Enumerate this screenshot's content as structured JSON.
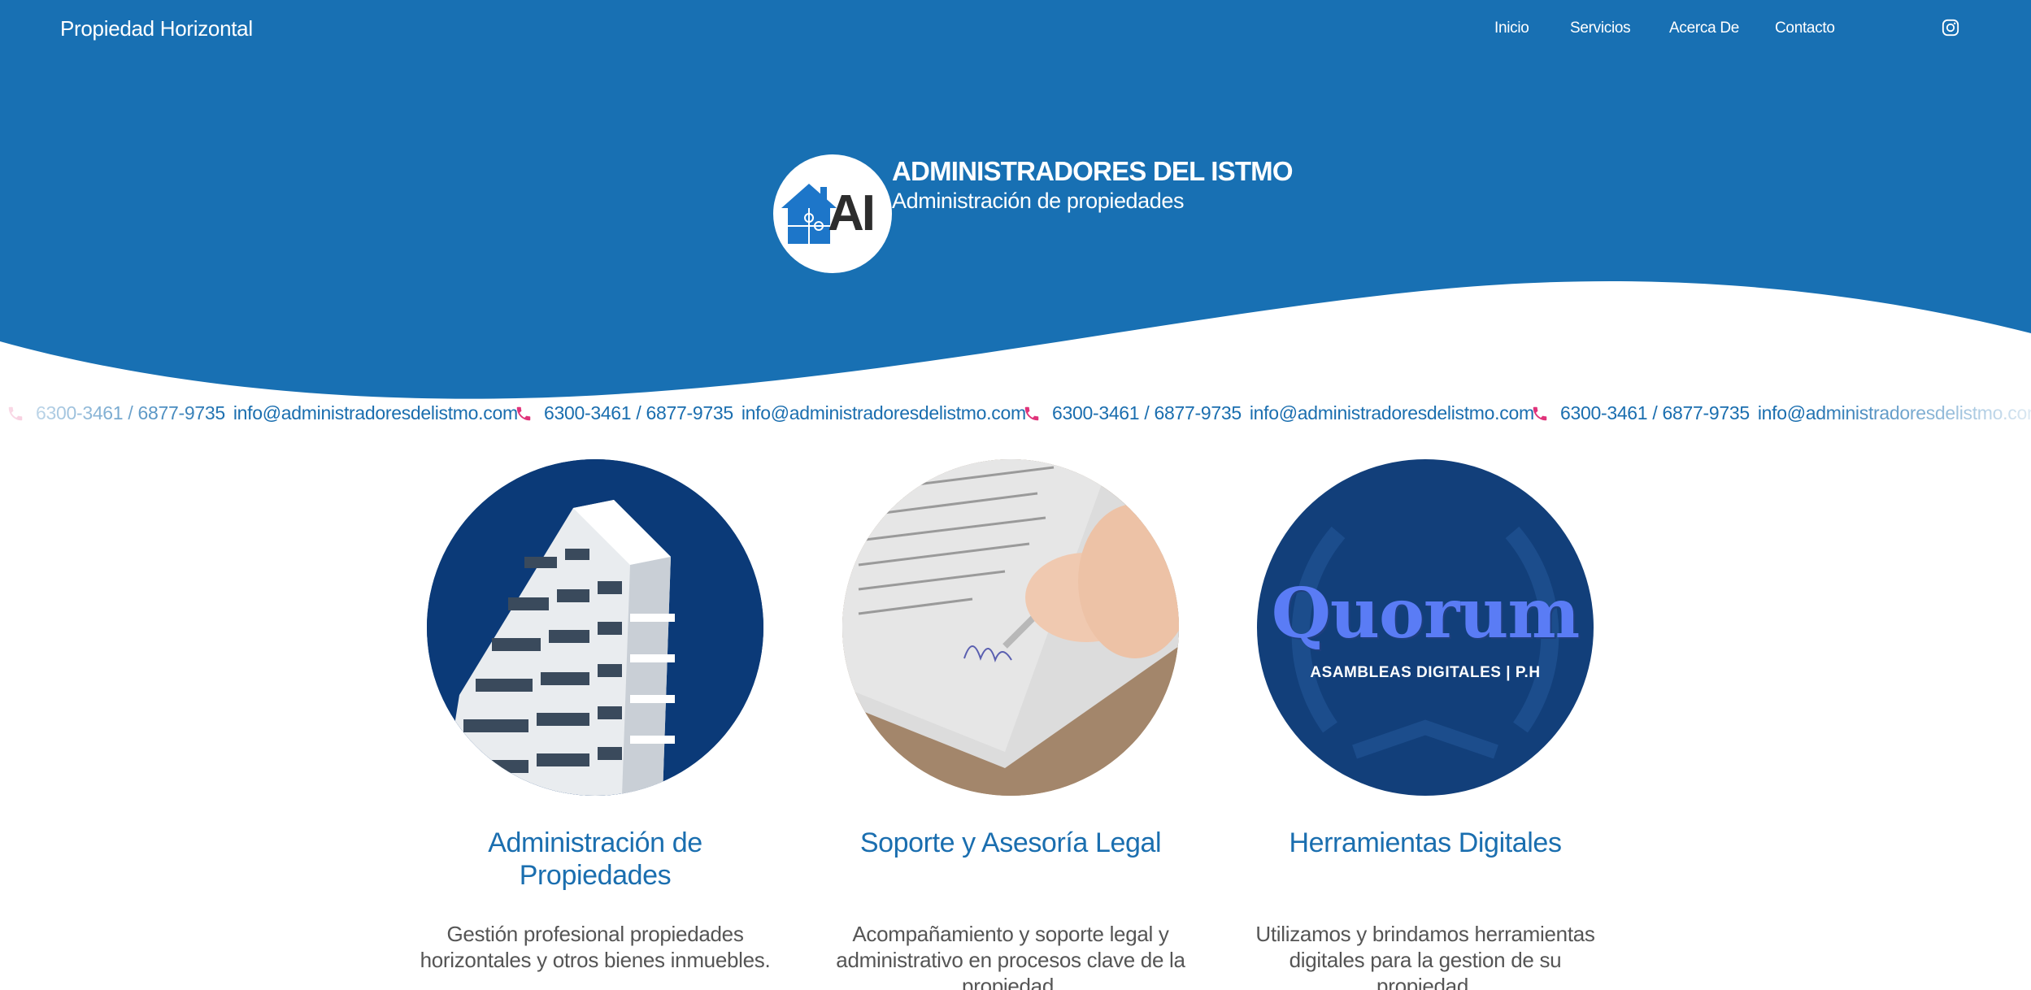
{
  "nav": {
    "brand": "Propiedad Horizontal",
    "links": [
      "Inicio",
      "Servicios",
      "Acerca De",
      "Contacto"
    ],
    "instagram_icon": "instagram-icon"
  },
  "hero": {
    "logo_text": "AI",
    "title": "ADMINISTRADORES DEL ISTMO",
    "subtitle": "Administración de propiedades"
  },
  "contact_ticker": {
    "phones": "6300-3461 / 6877-9735",
    "email": "info@administradoresdelistmo.com",
    "phone_icon": "phone-icon",
    "repeats": 4
  },
  "services": [
    {
      "title": "Administración de Propiedades",
      "description": "Gestión profesional propiedades horizontales y otros bienes inmuebles.",
      "image": "building-photo"
    },
    {
      "title": "Soporte y Asesoría Legal",
      "description": "Acompañamiento y soporte legal y administrativo en procesos clave de la propiedad.",
      "image": "signing-document-photo"
    },
    {
      "title": "Herramientas Digitales",
      "description": "Utilizamos y brindamos herramientas digitales para la gestion de su propiedad.",
      "image": "quorum-logo",
      "image_text": "Quorum",
      "image_subtext": "ASAMBLEAS DIGITALES | P.H"
    }
  ],
  "colors": {
    "primary_blue": "#1870b3",
    "navy": "#123f7a",
    "accent_pink": "#e0337a",
    "text_gray": "#555555"
  }
}
